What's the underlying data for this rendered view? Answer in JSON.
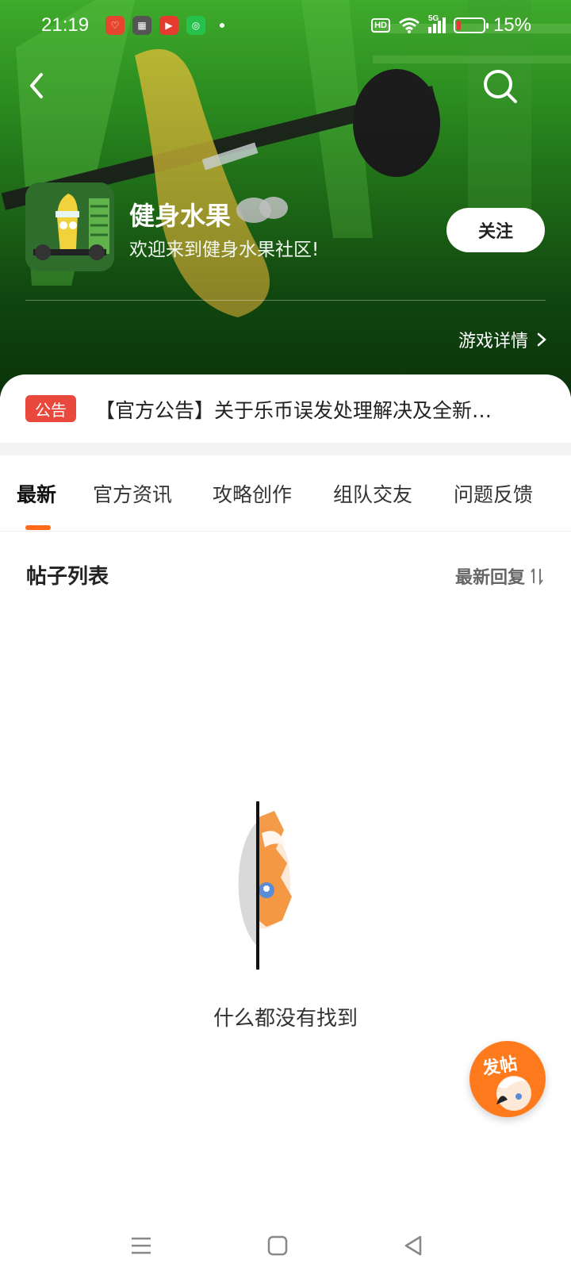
{
  "status_bar": {
    "time": "21:19",
    "hd": "HD",
    "network": "5G",
    "battery_percent": "15%",
    "battery_level": 0.15
  },
  "header": {
    "back_icon": "chevron-left-icon",
    "search_icon": "search-icon"
  },
  "game": {
    "title": "健身水果",
    "subtitle": "欢迎来到健身水果社区!",
    "follow_label": "关注",
    "detail_link": "游戏详情"
  },
  "notice": {
    "badge": "公告",
    "text": "【官方公告】关于乐币误发处理解决及全新…"
  },
  "tabs": [
    {
      "label": "最新",
      "active": true
    },
    {
      "label": "官方资讯",
      "active": false
    },
    {
      "label": "攻略创作",
      "active": false
    },
    {
      "label": "组队交友",
      "active": false
    },
    {
      "label": "问题反馈",
      "active": false
    }
  ],
  "list": {
    "title": "帖子列表",
    "sort_label": "最新回复",
    "empty_text": "什么都没有找到"
  },
  "fab": {
    "label": "发帖"
  },
  "colors": {
    "accent": "#ff6a1a",
    "notice_badge": "#e9483d",
    "hero_green": "#2f9a22"
  }
}
